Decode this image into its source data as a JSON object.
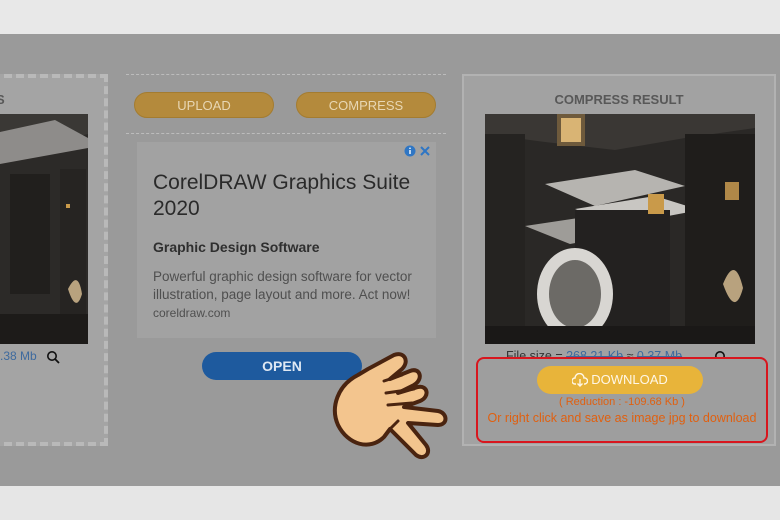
{
  "left_panel": {
    "title": "S",
    "file_size": ".38 Mb"
  },
  "toolbar": {
    "upload_label": "UPLOAD",
    "compress_label": "COMPRESS"
  },
  "ad": {
    "title": "CorelDRAW Graphics Suite 2020",
    "subtitle": "Graphic Design Software",
    "description": "Powerful graphic design software for vector illustration, page layout and more. Act now!",
    "domain": "coreldraw.com",
    "open_label": "OPEN"
  },
  "result": {
    "title": "COMPRESS RESULT",
    "file_size_label": "File size = ",
    "original_size": "268.21 Kb",
    "arrow": " ≈ ",
    "new_size": "0.37 Mb",
    "download_label": "DOWNLOAD",
    "reduction": "( Reduction : -109.68 Kb )",
    "save_note": "Or right click and save as image jpg to download"
  },
  "colors": {
    "accent": "#e8b43a",
    "highlight_border": "#d8161e",
    "note_text": "#e06010",
    "link": "#3e6a9e"
  },
  "icons": [
    "search-icon",
    "info-icon",
    "close-icon",
    "cloud-download-icon",
    "pointing-hand-icon"
  ]
}
